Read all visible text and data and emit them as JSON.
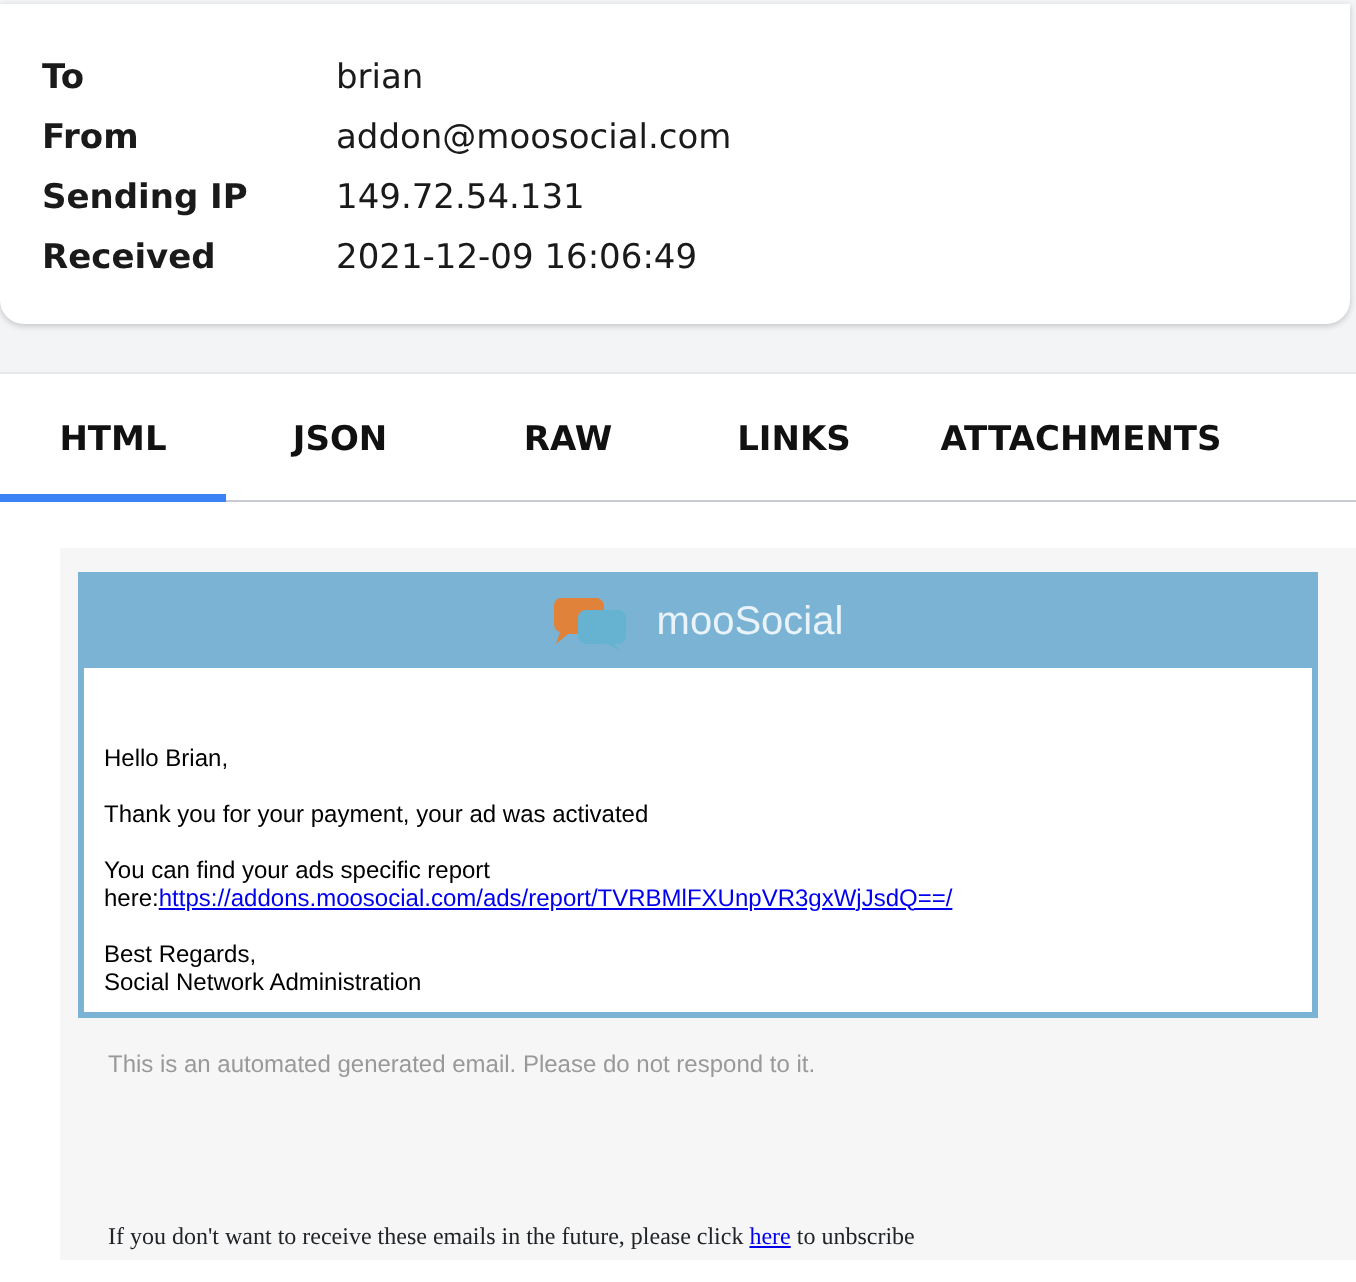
{
  "headers": [
    {
      "label": "To",
      "value": "brian"
    },
    {
      "label": "From",
      "value": "addon@moosocial.com"
    },
    {
      "label": "Sending IP",
      "value": "149.72.54.131"
    },
    {
      "label": "Received",
      "value": "2021-12-09 16:06:49"
    }
  ],
  "tabs": [
    {
      "label": "HTML",
      "selected": true
    },
    {
      "label": "JSON",
      "selected": false
    },
    {
      "label": "RAW",
      "selected": false
    },
    {
      "label": "LINKS",
      "selected": false
    },
    {
      "label": "ATTACHMENTS",
      "selected": false
    }
  ],
  "email": {
    "brand": "mooSocial",
    "greeting": "Hello Brian,",
    "message": "Thank you for your payment, your ad was activated",
    "report": {
      "text": "You can find your ads specific report",
      "prefix": "here:",
      "link": "https://addons.moosocial.com/ads/report/TVRBMlFXUnpVR3gxWjJsdQ==/"
    },
    "closing": [
      "Best Regards,",
      "Social Network Administration"
    ],
    "notice": "This is an automated generated email. Please do not respond to it.",
    "unsubscribe": {
      "before": "If you don't want to receive these emails in the future, please click",
      "link": "here",
      "after": "to unbscribe"
    }
  }
}
